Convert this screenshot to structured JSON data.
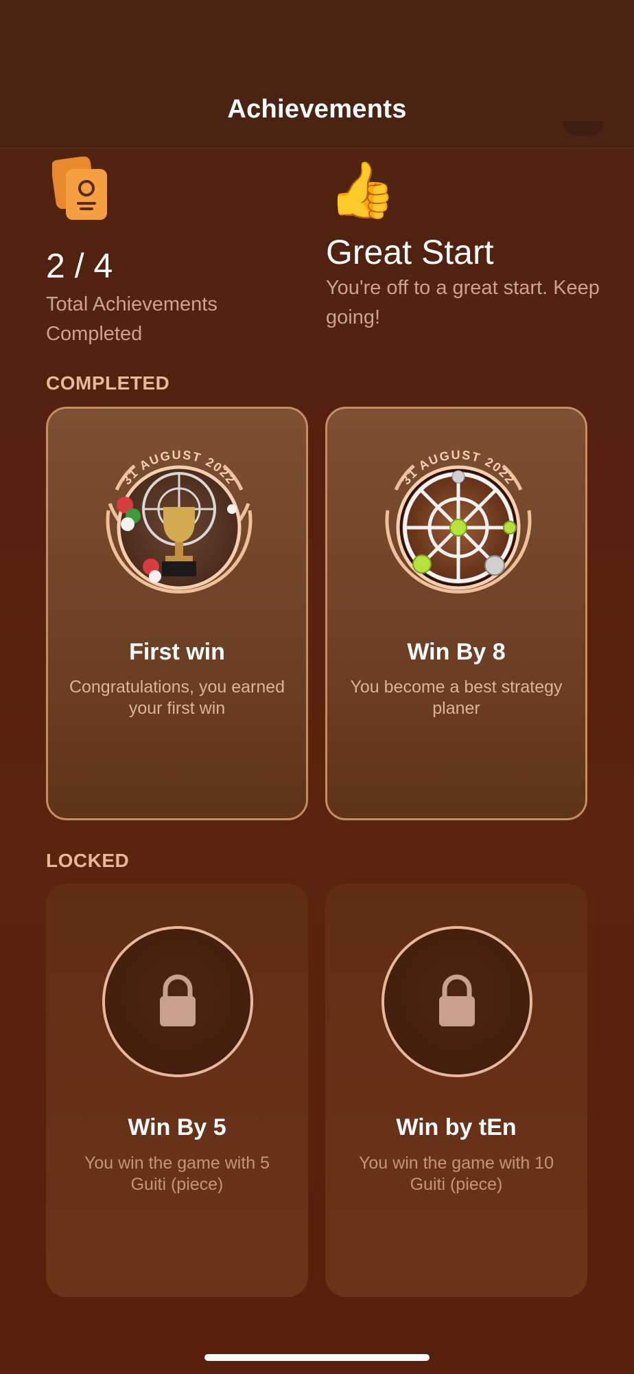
{
  "header": {
    "title": "Achievements"
  },
  "summary": {
    "count": "2 / 4",
    "count_label": "Total Achievements Completed",
    "icon": "badge-cards-icon",
    "status_icon": "👍",
    "status_title": "Great Start",
    "status_desc": "You're off to a great start. Keep going!"
  },
  "sections": {
    "completed": "COMPLETED",
    "locked": "LOCKED"
  },
  "completed": [
    {
      "date": "31 AUGUST 2022",
      "title": "First win",
      "desc": "Congratulations, you earned your first win",
      "icon": "trophy-icon"
    },
    {
      "date": "31 AUGUST 2022",
      "title": "Win By 8",
      "desc": "You become a best strategy planer",
      "icon": "game-board-icon"
    }
  ],
  "locked": [
    {
      "title": "Win By 5",
      "desc": "You win the game with 5 Guiti (piece)",
      "icon": "lock-icon"
    },
    {
      "title": "Win by tEn",
      "desc": "You win the game with 10 Guiti (piece)",
      "icon": "lock-icon"
    }
  ],
  "colors": {
    "background": "#55210f",
    "header": "#4a2313",
    "accent": "#e8b898",
    "muted_text": "#c9a58d",
    "card_border": "#c78d63"
  }
}
